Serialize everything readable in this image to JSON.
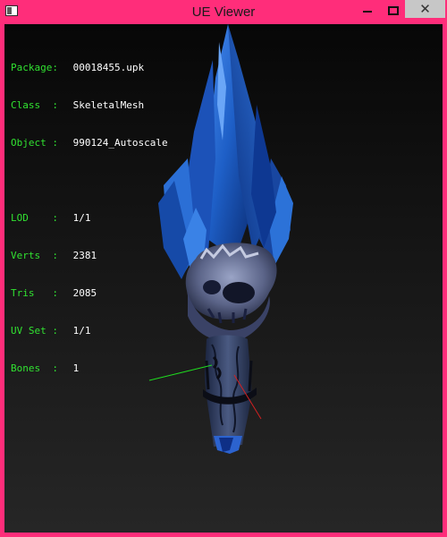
{
  "window": {
    "title": "UE Viewer",
    "close_glyph": "✕",
    "icons": [
      "app-icon",
      "minimize-icon",
      "maximize-icon",
      "close-icon"
    ],
    "accent": "#ff2d7a"
  },
  "info": {
    "package": {
      "label": "Package:",
      "value": "00018455.upk"
    },
    "class": {
      "label": "Class  :",
      "value": "SkeletalMesh"
    },
    "object": {
      "label": "Object :",
      "value": "990124_Autoscale"
    },
    "lod": {
      "label": "LOD    :",
      "value": "1/1"
    },
    "verts": {
      "label": "Verts  :",
      "value": "2381"
    },
    "tris": {
      "label": "Tris   :",
      "value": "2085"
    },
    "uvset": {
      "label": "UV Set :",
      "value": "1/1"
    },
    "bones": {
      "label": "Bones  :",
      "value": "1"
    },
    "label_color": "#31e231",
    "value_color": "#ffffff"
  }
}
